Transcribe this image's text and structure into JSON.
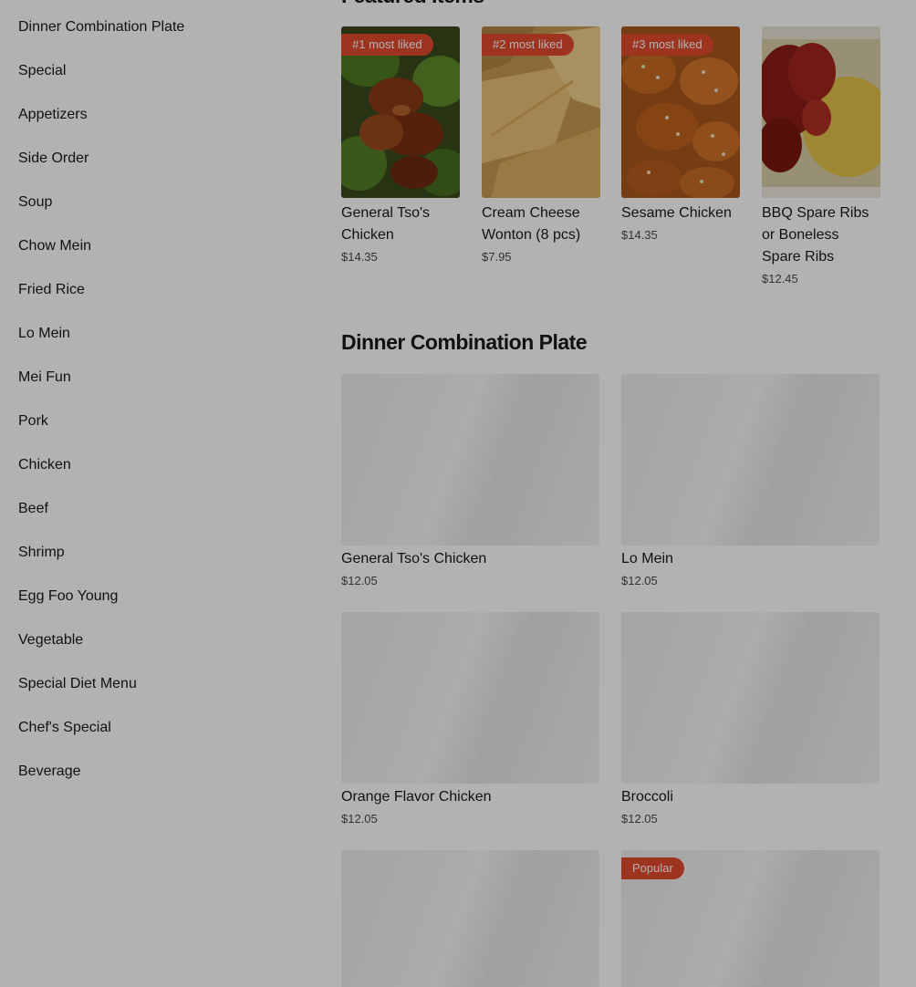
{
  "sidebar": {
    "items": [
      {
        "label": "Dinner Combination Plate"
      },
      {
        "label": "Special"
      },
      {
        "label": "Appetizers"
      },
      {
        "label": "Side Order"
      },
      {
        "label": "Soup"
      },
      {
        "label": "Chow Mein"
      },
      {
        "label": "Fried Rice"
      },
      {
        "label": "Lo Mein"
      },
      {
        "label": "Mei Fun"
      },
      {
        "label": "Pork"
      },
      {
        "label": "Chicken"
      },
      {
        "label": "Beef"
      },
      {
        "label": "Shrimp"
      },
      {
        "label": "Egg Foo Young"
      },
      {
        "label": "Vegetable"
      },
      {
        "label": "Special Diet Menu"
      },
      {
        "label": "Chef's Special"
      },
      {
        "label": "Beverage"
      }
    ]
  },
  "featured": {
    "title": "Featured Items",
    "prev_icon": "chevron-left-icon",
    "next_icon": "chevron-right-icon",
    "items": [
      {
        "badge": "#1 most liked",
        "name": "General Tso's Chicken",
        "price": "$14.35",
        "image": "general-tso-chicken-photo"
      },
      {
        "badge": "#2 most liked",
        "name": "Cream Cheese Wonton (8 pcs)",
        "price": "$7.95",
        "image": "cream-cheese-wonton-photo"
      },
      {
        "badge": "#3 most liked",
        "name": "Sesame Chicken",
        "price": "$14.35",
        "image": "sesame-chicken-photo"
      },
      {
        "badge": "",
        "name": "BBQ Spare Ribs or Boneless Spare Ribs",
        "price": "$12.45",
        "image": "bbq-spare-ribs-photo"
      }
    ]
  },
  "section": {
    "title": "Dinner Combination Plate",
    "items": [
      {
        "name": "General Tso's Chicken",
        "price": "$12.05",
        "badge": ""
      },
      {
        "name": "Lo Mein",
        "price": "$12.05",
        "badge": ""
      },
      {
        "name": "Orange Flavor Chicken",
        "price": "$12.05",
        "badge": ""
      },
      {
        "name": "Broccoli",
        "price": "$12.05",
        "badge": ""
      },
      {
        "name": "",
        "price": "",
        "badge": ""
      },
      {
        "name": "",
        "price": "",
        "badge": "Popular"
      }
    ]
  },
  "colors": {
    "badge": "#e24a2e",
    "overlay": "rgba(0,0,0,0.30)",
    "text": "#191919",
    "price_text": "#494949"
  }
}
